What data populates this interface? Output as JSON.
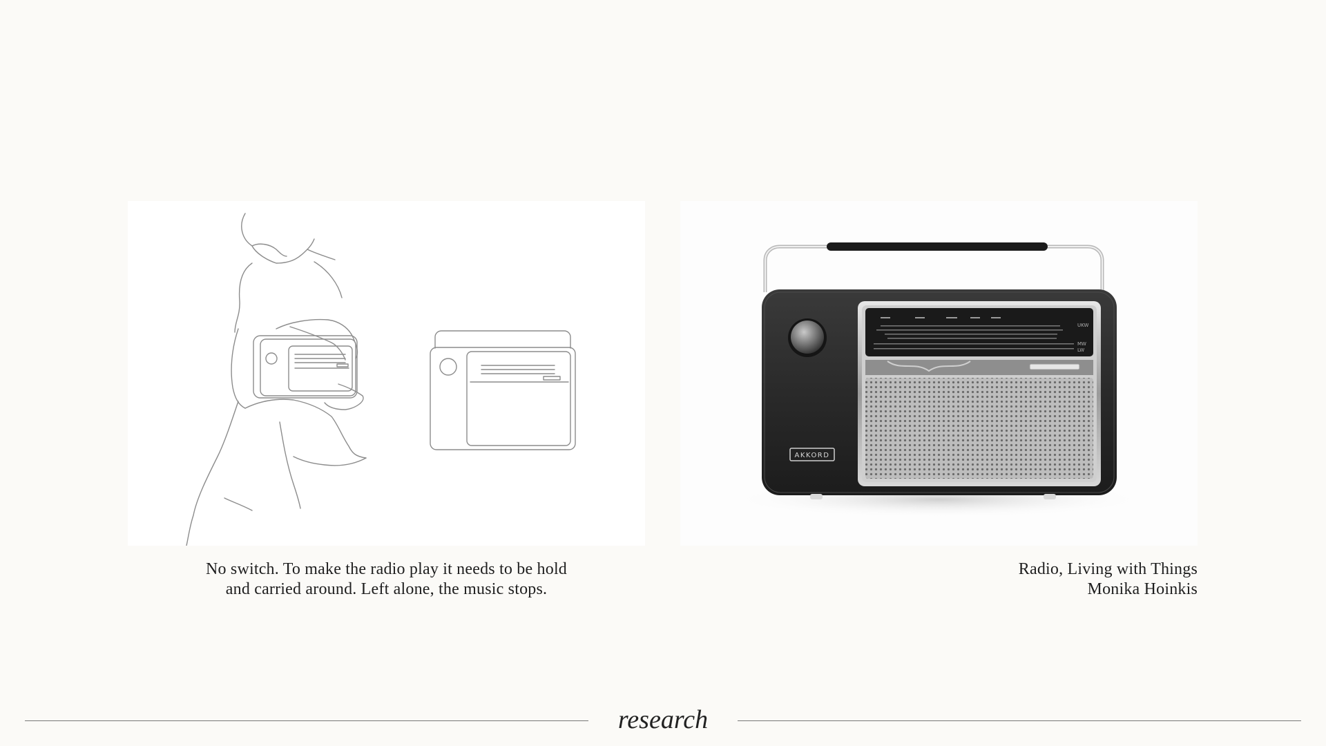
{
  "left_panel": {
    "illustration": "radio-hold-line-drawing",
    "caption_lines": [
      "No switch. To make the radio play it needs to be hold",
      "and carried around. Left alone, the music stops."
    ]
  },
  "right_panel": {
    "photo": "radio-photo",
    "brand_plate": "AKKORD",
    "dial_bands": [
      "UKW",
      "MW",
      "LW"
    ],
    "caption_lines": [
      "Radio, Living with Things",
      "Monika Hoinkis"
    ]
  },
  "footer": {
    "label": "research"
  }
}
